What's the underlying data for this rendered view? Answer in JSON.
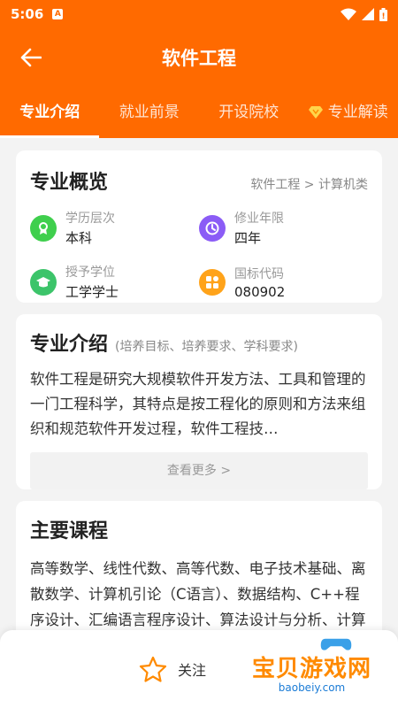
{
  "status_bar": {
    "time": "5:06",
    "a_badge": "A"
  },
  "header": {
    "title": "软件工程"
  },
  "tabs": [
    {
      "label": "专业介绍",
      "active": true
    },
    {
      "label": "就业前景",
      "active": false
    },
    {
      "label": "开设院校",
      "active": false
    },
    {
      "label": "专业解读",
      "active": false,
      "icon": "vip-diamond-icon"
    }
  ],
  "overview": {
    "title": "专业概览",
    "breadcrumb": "软件工程 > 计算机类",
    "items": [
      {
        "label": "学历层次",
        "value": "本科",
        "icon": "degree-level-icon",
        "color": "#3fcf4d"
      },
      {
        "label": "修业年限",
        "value": "四年",
        "icon": "clock-icon",
        "color": "#8b5cf6"
      },
      {
        "label": "授予学位",
        "value": "工学学士",
        "icon": "graduation-cap-icon",
        "color": "#3cc46a"
      },
      {
        "label": "国标代码",
        "value": "080902",
        "icon": "grid-code-icon",
        "color": "#ffa31a"
      }
    ]
  },
  "intro": {
    "title": "专业介绍",
    "subtitle": "(培养目标、培养要求、学科要求)",
    "body": "软件工程是研究大规模软件开发方法、工具和管理的一门工程科学，其特点是按工程化的原则和方法来组织和规范软件开发过程，软件工程技…",
    "more": "查看更多 >"
  },
  "courses": {
    "title": "主要课程",
    "body": "高等数学、线性代数、高等代数、电子技术基础、离散数学、计算机引论（C语言）、数据结构、C++程序设计、汇编语言程序设计、算法设计与分析、计算机组成原理、操作系统、数据库"
  },
  "bottom": {
    "follow_label": "关注"
  },
  "watermark": {
    "main": "宝贝游戏网",
    "sub": "baobeiy.com"
  },
  "colors": {
    "accent": "#ff6a00",
    "background": "#f3f3f3"
  }
}
